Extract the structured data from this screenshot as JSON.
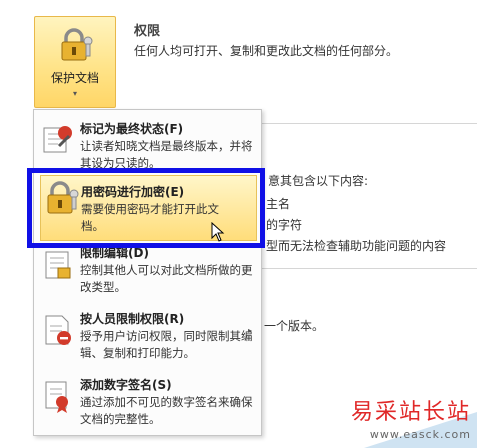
{
  "protect_button": {
    "label": "保护文档",
    "chevron": "▾",
    "icon": "lock-key-icon"
  },
  "permission": {
    "title": "权限",
    "description": "任何人均可打开、复制和更改此文档的任何部分。"
  },
  "background_fragments": [
    "意其包含以下内容:",
    "主名",
    "的字符",
    "型而无法检查辅助功能问题的内容",
    "一个版本。"
  ],
  "menu": {
    "items": [
      {
        "title": "标记为最终状态(F)",
        "desc": "让读者知晓文档是最终版本，并将其设为只读的。",
        "icon": "mark-final-icon",
        "has_submenu": false
      },
      {
        "title": "用密码进行加密(E)",
        "desc": "需要使用密码才能打开此文档。",
        "icon": "lock-key-icon",
        "has_submenu": false,
        "highlighted": true
      },
      {
        "title": "限制编辑(D)",
        "desc": "控制其他人可以对此文档所做的更改类型。",
        "icon": "restrict-editing-icon",
        "has_submenu": false
      },
      {
        "title": "按人员限制权限(R)",
        "desc": "授予用户访问权限，同时限制其编辑、复制和打印能力。",
        "icon": "restrict-permission-icon",
        "has_submenu": true
      },
      {
        "title": "添加数字签名(S)",
        "desc": "通过添加不可见的数字签名来确保文档的完整性。",
        "icon": "digital-signature-icon",
        "has_submenu": false
      }
    ],
    "submenu_arrow": "▸"
  },
  "watermark": {
    "text": "易采站长站",
    "url": "www.easck.com"
  },
  "colors": {
    "highlight": "#ffe79a",
    "selection_box": "#1010e6",
    "watermark": "#e02828"
  }
}
